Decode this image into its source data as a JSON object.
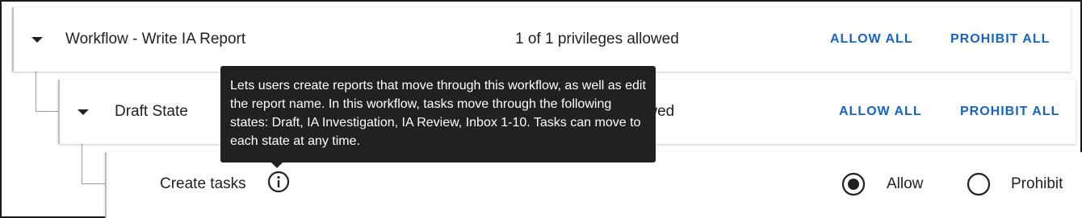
{
  "workflow": {
    "title": "Workflow - Write IA Report",
    "privileges_text": "1 of 1 privileges allowed",
    "allow_all_label": "ALLOW ALL",
    "prohibit_all_label": "PROHIBIT ALL",
    "expanded": true
  },
  "state": {
    "title": "Draft State",
    "privileges_text": "s allowed",
    "allow_all_label": "ALLOW ALL",
    "prohibit_all_label": "PROHIBIT ALL",
    "expanded": true
  },
  "privilege": {
    "label": "Create tasks",
    "info_icon": "info-circle-icon",
    "options": [
      {
        "label": "Allow",
        "selected": true
      },
      {
        "label": "Prohibit",
        "selected": false
      }
    ]
  },
  "tooltip": {
    "text": "Lets users create reports that move through this workflow, as well as edit the report name. In this workflow, tasks move through the following states: Draft, IA Investigation, IA Review, Inbox 1-10. Tasks can move to each state at any time."
  },
  "colors": {
    "accent": "#1565c0",
    "tooltip_bg": "#212121",
    "text": "#212121"
  }
}
